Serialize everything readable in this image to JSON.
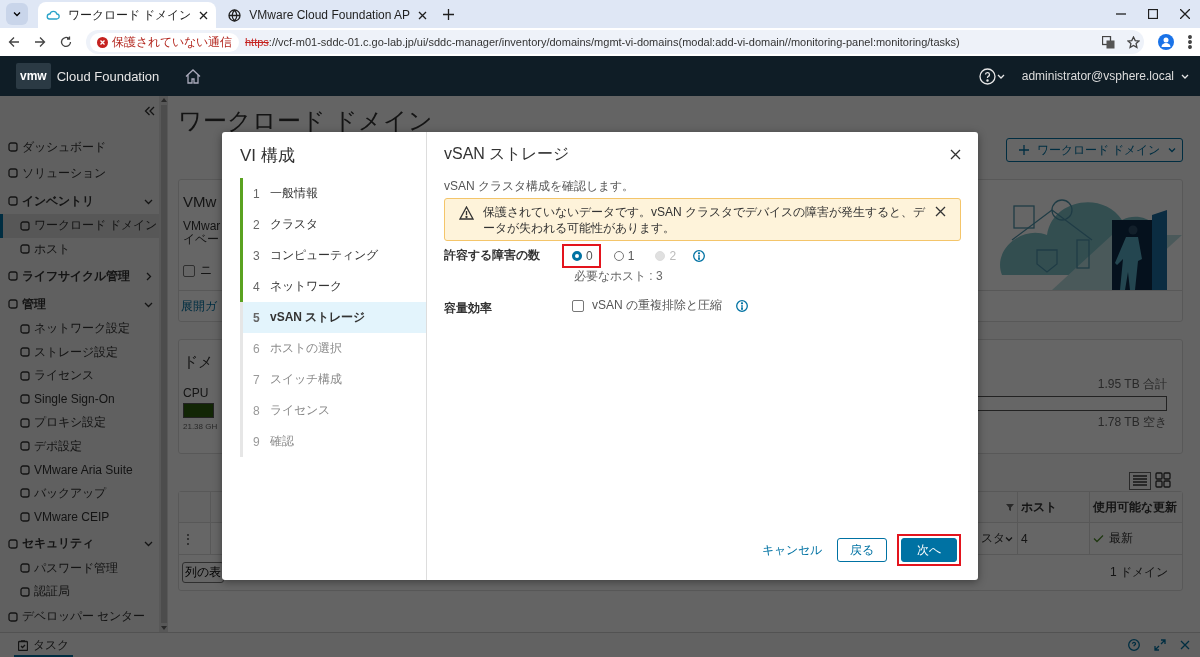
{
  "browser": {
    "tabs": [
      {
        "title": "ワークロード ドメイン",
        "selected": true
      },
      {
        "title": "VMware Cloud Foundation AP",
        "selected": false
      }
    ],
    "security_label": "保護されていない通信",
    "url_scheme": "https",
    "url_rest": "://vcf-m01-sddc-01.c.go-lab.jp/ui/sddc-manager/inventory/domains/mgmt-vi-domains(modal:add-vi-domain//monitoring-panel:monitoring/tasks)"
  },
  "header": {
    "logo": "vmw",
    "product": "Cloud Foundation",
    "user": "administrator@vsphere.local"
  },
  "sidebar": {
    "items": [
      {
        "label": "ダッシュボード",
        "selected": false
      },
      {
        "label": "ソリューション",
        "selected": false
      },
      {
        "label": "インベントリ",
        "selected": false,
        "expanded": true,
        "children": [
          {
            "label": "ワークロード ドメイン",
            "selected": true
          },
          {
            "label": "ホスト",
            "selected": false
          }
        ]
      },
      {
        "label": "ライフサイクル管理",
        "selected": false,
        "expanded": false
      },
      {
        "label": "管理",
        "selected": false,
        "expanded": true,
        "children": [
          {
            "label": "ネットワーク設定",
            "selected": false
          },
          {
            "label": "ストレージ設定",
            "selected": false
          },
          {
            "label": "ライセンス",
            "selected": false
          },
          {
            "label": "Single Sign-On",
            "selected": false
          },
          {
            "label": "プロキシ設定",
            "selected": false
          },
          {
            "label": "デポ設定",
            "selected": false
          },
          {
            "label": "VMware Aria Suite",
            "selected": false
          },
          {
            "label": "バックアップ",
            "selected": false
          },
          {
            "label": "VMware CEIP",
            "selected": false
          }
        ]
      },
      {
        "label": "セキュリティ",
        "selected": false,
        "expanded": true,
        "children": [
          {
            "label": "パスワード管理",
            "selected": false
          },
          {
            "label": "認証局",
            "selected": false
          }
        ]
      },
      {
        "label": "デベロッパー センター",
        "selected": false
      }
    ]
  },
  "page": {
    "title": "ワークロード ドメイン",
    "add_button": "ワークロード ドメイン",
    "intro_card": {
      "heading": "VMw",
      "lines": [
        "VMwar",
        "イベー"
      ],
      "checkbox": {
        "label": "ニ",
        "checked": false
      },
      "link": "展開ガ"
    },
    "usage_card": {
      "heading": "ドメ",
      "cpu_label": "CPU",
      "cpu_reading": "21.38 GH",
      "storage_total": "1.95 TB 合計",
      "storage_free": "1.78 TB 空き"
    },
    "table": {
      "columns": [
        "ホスト",
        "使用可能な更新"
      ],
      "rows": [
        {
          "actions": "⋮",
          "column_3": "スタ",
          "hosts": "4",
          "updates": "最新"
        }
      ],
      "footer_button": "列の表",
      "count": "1 ドメイン"
    }
  },
  "wizard": {
    "title": "VI 構成",
    "steps": [
      {
        "number": "1",
        "label": "一般情報",
        "kind": "done",
        "selected": false
      },
      {
        "number": "2",
        "label": "クラスタ",
        "kind": "done",
        "selected": false
      },
      {
        "number": "3",
        "label": "コンピューティング",
        "kind": "done",
        "selected": false
      },
      {
        "number": "4",
        "label": "ネットワーク",
        "kind": "done",
        "selected": false
      },
      {
        "number": "5",
        "label": "vSAN ストレージ",
        "kind": "current",
        "selected": true
      },
      {
        "number": "6",
        "label": "ホストの選択",
        "kind": "pending",
        "selected": false
      },
      {
        "number": "7",
        "label": "スイッチ構成",
        "kind": "pending",
        "selected": false
      },
      {
        "number": "8",
        "label": "ライセンス",
        "kind": "pending",
        "selected": false
      },
      {
        "number": "9",
        "label": "確認",
        "kind": "pending",
        "selected": false
      }
    ],
    "panel": {
      "title": "vSAN ストレージ",
      "description": "vSAN クラスタ構成を確認します。",
      "alert": {
        "kind": "warning",
        "text": "保護されていないデータです。vSAN クラスタでデバイスの障害が発生すると、データが失われる可能性があります。"
      },
      "fields": [
        {
          "kind": "radio",
          "label": "許容する障害の数",
          "options": [
            {
              "label": "0",
              "selected": true,
              "disabled": false,
              "highlighted": true
            },
            {
              "label": "1",
              "selected": false,
              "disabled": false,
              "highlighted": false
            },
            {
              "label": "2",
              "selected": false,
              "disabled": true,
              "highlighted": false
            }
          ],
          "help": "必要なホスト : 3"
        },
        {
          "kind": "checkbox",
          "label": "容量効率",
          "option": {
            "label": "vSAN の重複排除と圧縮",
            "checked": false
          }
        }
      ],
      "buttons": [
        {
          "label": "キャンセル",
          "kind": "link",
          "highlighted": false
        },
        {
          "label": "戻る",
          "kind": "secondary",
          "highlighted": false
        },
        {
          "label": "次へ",
          "kind": "primary",
          "highlighted": true
        }
      ]
    }
  },
  "taskbar": {
    "tabs": [
      {
        "label": "タスク",
        "selected": true
      }
    ]
  }
}
